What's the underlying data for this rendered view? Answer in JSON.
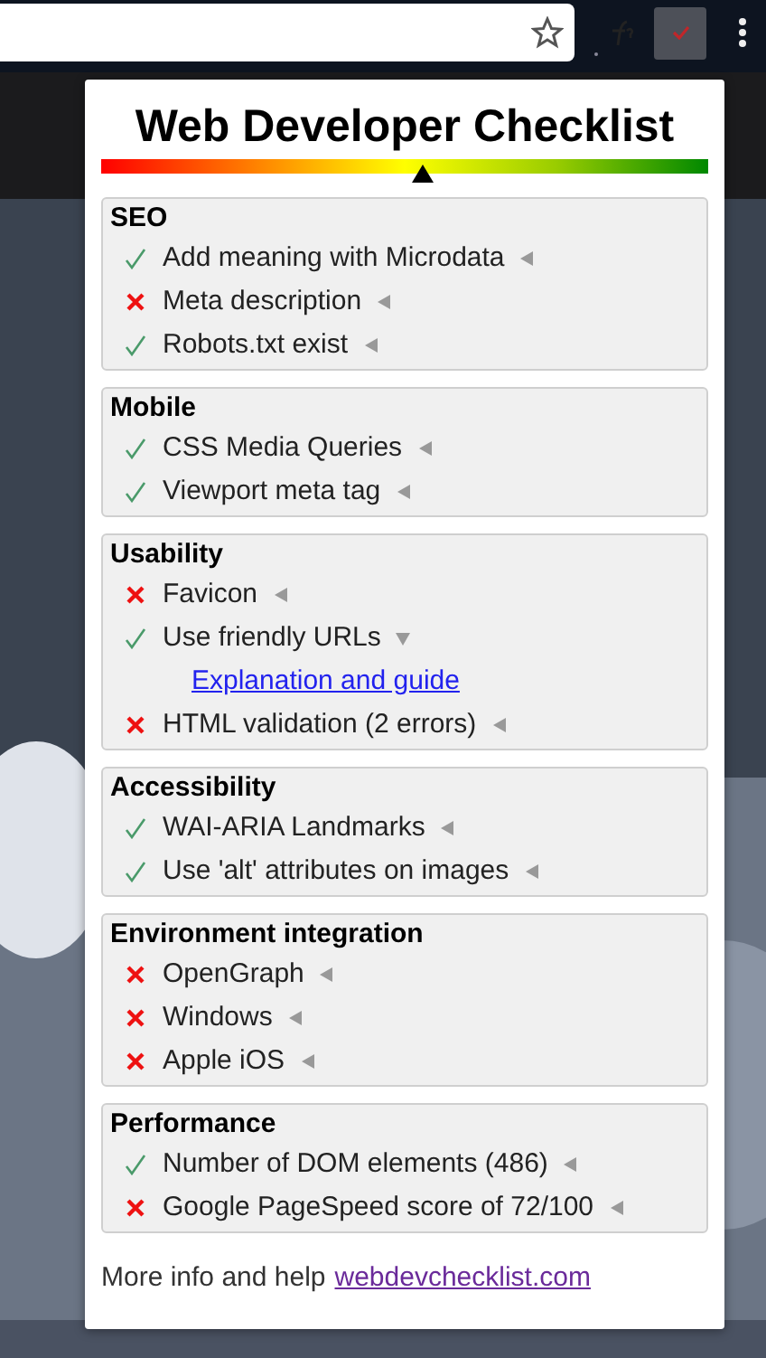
{
  "popup": {
    "title": "Web Developer Checklist",
    "score": {
      "level": 0.53
    },
    "sections": [
      {
        "title": "SEO",
        "items": [
          {
            "label": "Add meaning with Microdata",
            "passed": true,
            "expanded": false
          },
          {
            "label": "Meta description",
            "passed": false,
            "expanded": false
          },
          {
            "label": "Robots.txt exist",
            "passed": true,
            "expanded": false
          }
        ]
      },
      {
        "title": "Mobile",
        "items": [
          {
            "label": "CSS Media Queries",
            "passed": true,
            "expanded": false
          },
          {
            "label": "Viewport meta tag",
            "passed": true,
            "expanded": false
          }
        ]
      },
      {
        "title": "Usability",
        "items": [
          {
            "label": "Favicon",
            "passed": false,
            "expanded": false
          },
          {
            "label": "Use friendly URLs",
            "passed": true,
            "expanded": true,
            "link": "Explanation and guide"
          },
          {
            "label": "HTML validation (2 errors)",
            "passed": false,
            "expanded": false
          }
        ]
      },
      {
        "title": "Accessibility",
        "items": [
          {
            "label": "WAI-ARIA Landmarks",
            "passed": true,
            "expanded": false
          },
          {
            "label": "Use 'alt' attributes on images",
            "passed": true,
            "expanded": false
          }
        ]
      },
      {
        "title": "Environment integration",
        "items": [
          {
            "label": "OpenGraph",
            "passed": false,
            "expanded": false
          },
          {
            "label": "Windows",
            "passed": false,
            "expanded": false
          },
          {
            "label": "Apple iOS",
            "passed": false,
            "expanded": false
          }
        ]
      },
      {
        "title": "Performance",
        "items": [
          {
            "label": "Number of DOM elements (486)",
            "passed": true,
            "expanded": false
          },
          {
            "label": "Google PageSpeed score of 72/100",
            "passed": false,
            "expanded": false
          }
        ]
      }
    ],
    "footer": {
      "text": "More info and help",
      "link": "webdevchecklist.com"
    }
  }
}
